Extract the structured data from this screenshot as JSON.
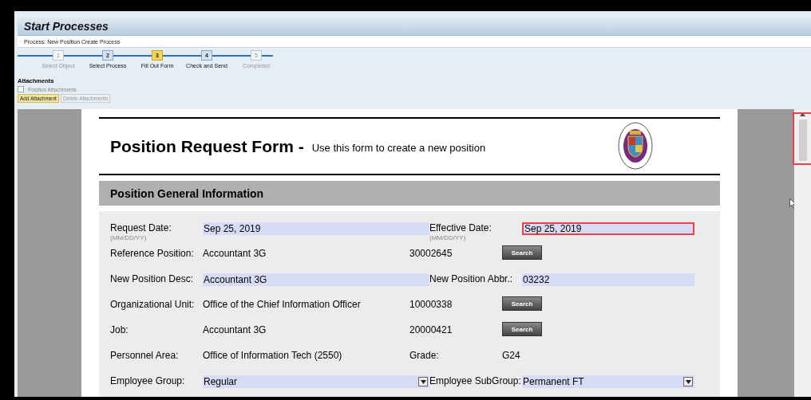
{
  "header": {
    "title": "Start Processes",
    "process": "Process: New Position Create Process"
  },
  "steps": [
    {
      "number": "1",
      "label": "Select Object",
      "selected": false,
      "disabled": true
    },
    {
      "number": "2",
      "label": "Select Process",
      "selected": false,
      "disabled": false
    },
    {
      "number": "3",
      "label": "Fill Out Form",
      "selected": true,
      "disabled": false
    },
    {
      "number": "4",
      "label": "Check and Send",
      "selected": false,
      "disabled": false
    },
    {
      "number": "5",
      "label": "Completed",
      "selected": false,
      "disabled": true
    }
  ],
  "attachments": {
    "title": "Attachments",
    "items": [
      {
        "label": "Position Attachments",
        "checked": false
      }
    ],
    "buttons": [
      {
        "label": "Add Attachment",
        "disabled": false
      },
      {
        "label": "Delete Attachments",
        "disabled": true
      }
    ]
  },
  "form": {
    "title": "Position Request Form -",
    "subtitle": "Use this form to create a new position",
    "section": "Position General Information",
    "rows": [
      [
        {
          "label": "Request Date:",
          "hint": "(MM/DD/YY)",
          "kind": "input",
          "value": "Sep 25, 2019",
          "highlighted": false
        },
        {
          "label": "Effective Date:",
          "hint": "(MM/DD/YY)",
          "kind": "input",
          "value": "Sep 25, 2019",
          "highlighted": true
        }
      ],
      [
        {
          "label": "Reference Position:",
          "kind": "text",
          "value": "Accountant 3G"
        },
        {
          "label": "30002645",
          "kind": "button",
          "value": "Search"
        }
      ],
      [
        {
          "label": "New Position Desc:",
          "kind": "input",
          "value": "Accountant 3G",
          "highlighted": false
        },
        {
          "label": "New Position Abbr.:",
          "kind": "input",
          "value": "03232",
          "highlighted": false
        }
      ],
      [
        {
          "label": "Organizational Unit:",
          "kind": "text",
          "value": "Office of the Chief Information Officer"
        },
        {
          "label": "10000338",
          "kind": "button",
          "value": "Search"
        }
      ],
      [
        {
          "label": "Job:",
          "kind": "text",
          "value": "Accountant 3G"
        },
        {
          "label": "20000421",
          "kind": "button",
          "value": "Search"
        }
      ],
      [
        {
          "label": "Personnel Area:",
          "kind": "text",
          "value": "Office of Information Tech (2550)"
        },
        {
          "label": "Grade:",
          "kind": "text",
          "value": "G24"
        }
      ],
      [
        {
          "label": "Employee Group:",
          "kind": "select",
          "value": "Regular"
        },
        {
          "label": "Employee SubGroup:",
          "kind": "select",
          "value": "Permanent FT"
        }
      ]
    ]
  },
  "scrollbar": {
    "highlighted": true
  }
}
